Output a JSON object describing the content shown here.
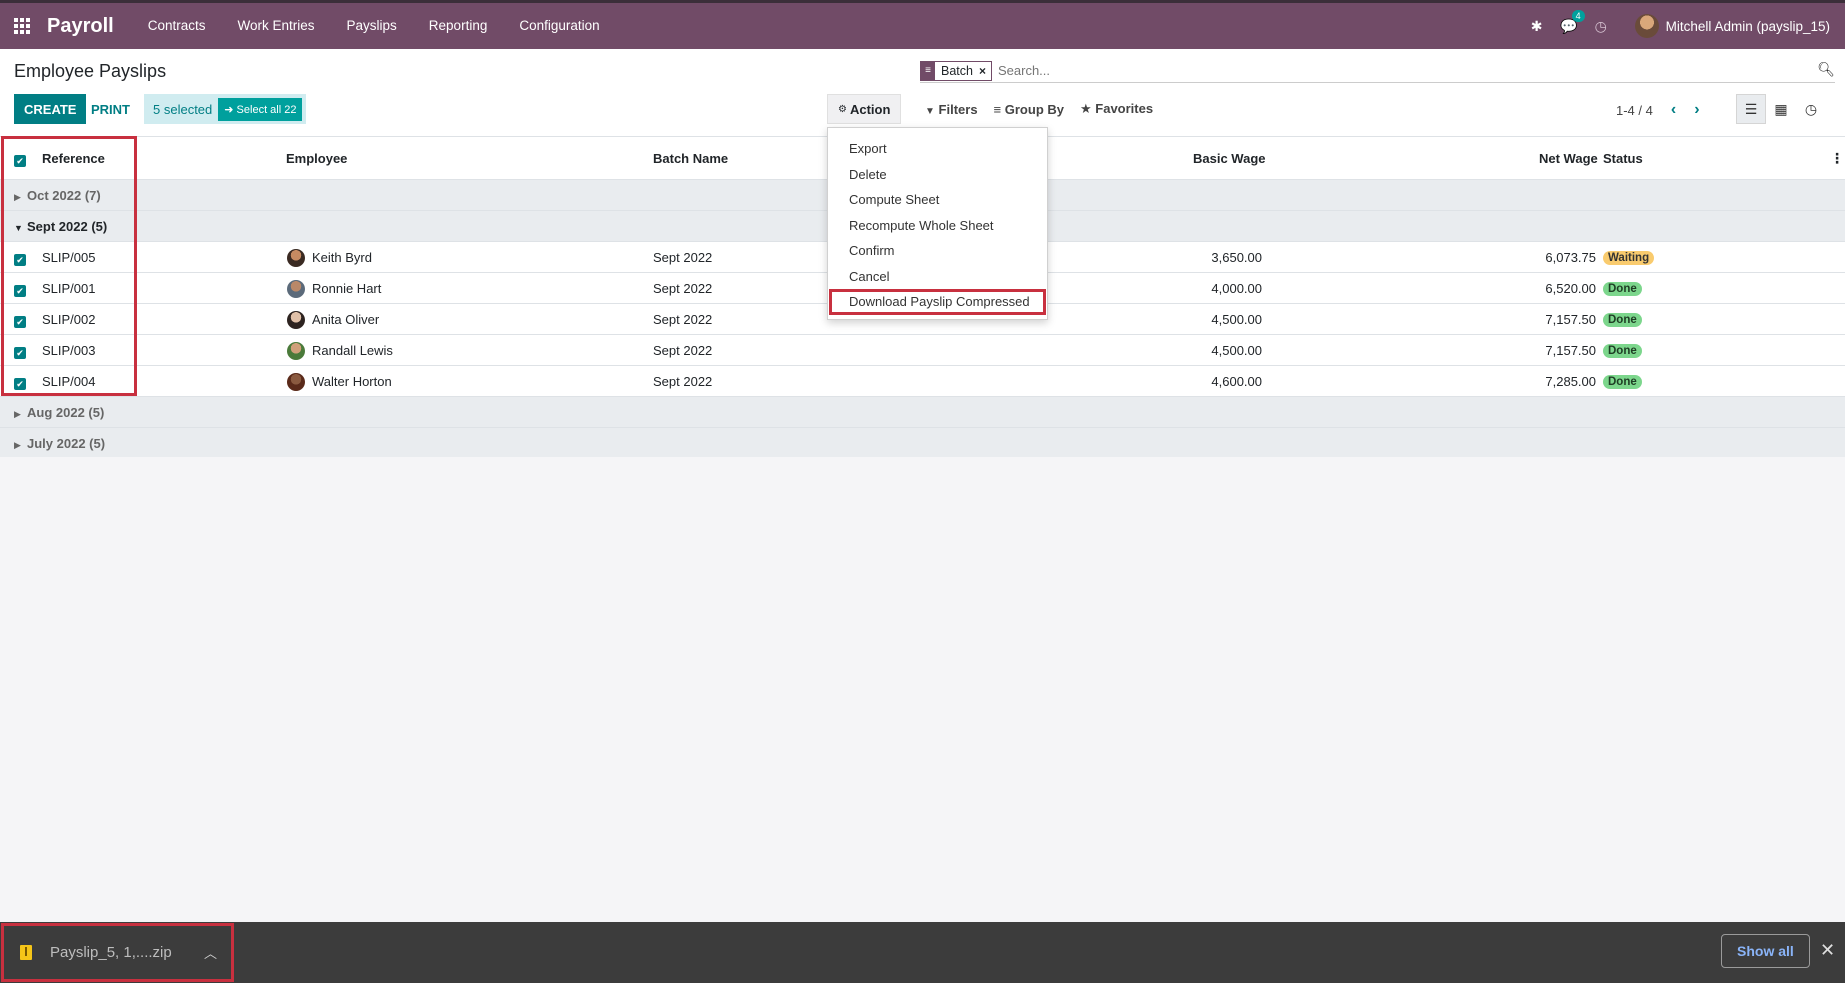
{
  "navbar": {
    "app_name": "Payroll",
    "menu": [
      "Contracts",
      "Work Entries",
      "Payslips",
      "Reporting",
      "Configuration"
    ],
    "message_count": "4",
    "user": "Mitchell Admin (payslip_15)"
  },
  "control": {
    "title": "Employee Payslips",
    "create_label": "CREATE",
    "print_label": "PRINT",
    "selected_text": "5 selected",
    "select_all_label": "Select all 22",
    "action_label": "Action",
    "search": {
      "facet": "Batch",
      "placeholder": "Search..."
    },
    "filters_label": "Filters",
    "groupby_label": "Group By",
    "favorites_label": "Favorites",
    "pager": "1-4 / 4"
  },
  "table": {
    "headers": {
      "reference": "Reference",
      "employee": "Employee",
      "batch_name": "Batch Name",
      "basic_wage": "Basic Wage",
      "net_wage": "Net Wage",
      "status": "Status"
    },
    "groups_top": [
      {
        "label": "Oct 2022 (7)"
      }
    ],
    "open_group": {
      "label": "Sept 2022 (5)"
    },
    "rows": [
      {
        "ref": "SLIP/005",
        "employee": "Keith Byrd",
        "batch": "Sept 2022",
        "basic": "3,650.00",
        "net": "6,073.75",
        "status": "Waiting"
      },
      {
        "ref": "SLIP/001",
        "employee": "Ronnie Hart",
        "batch": "Sept 2022",
        "basic": "4,000.00",
        "net": "6,520.00",
        "status": "Done"
      },
      {
        "ref": "SLIP/002",
        "employee": "Anita Oliver",
        "batch": "Sept 2022",
        "basic": "4,500.00",
        "net": "7,157.50",
        "status": "Done"
      },
      {
        "ref": "SLIP/003",
        "employee": "Randall Lewis",
        "batch": "Sept 2022",
        "basic": "4,500.00",
        "net": "7,157.50",
        "status": "Done"
      },
      {
        "ref": "SLIP/004",
        "employee": "Walter Horton",
        "batch": "Sept 2022",
        "basic": "4,600.00",
        "net": "7,285.00",
        "status": "Done"
      }
    ],
    "groups_bottom": [
      {
        "label": "Aug 2022 (5)"
      },
      {
        "label": "July 2022 (5)"
      }
    ]
  },
  "action_menu": [
    "Export",
    "Delete",
    "Compute Sheet",
    "Recompute Whole Sheet",
    "Confirm",
    "Cancel",
    "Download Payslip Compressed"
  ],
  "download_bar": {
    "file_name": "Payslip_5, 1,....zip",
    "show_all_label": "Show all"
  },
  "colors": {
    "brand": "#714B67",
    "accent": "#017e84",
    "waiting": "#f9cb6e",
    "done": "#7cd68c",
    "annotation": "#c8303f"
  }
}
